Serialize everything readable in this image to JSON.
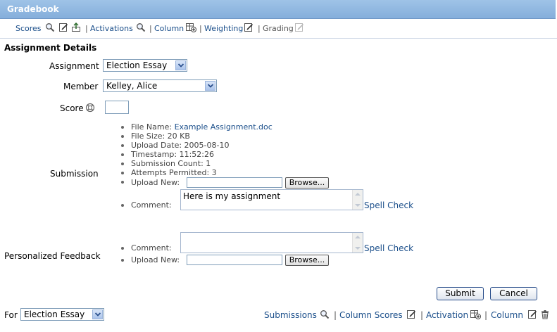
{
  "window": {
    "title": "Gradebook"
  },
  "toolbar": {
    "scores": "Scores",
    "activations": "Activations",
    "column": "Column",
    "weighting": "Weighting",
    "grading": "Grading",
    "separator": "|"
  },
  "section": {
    "title": "Assignment Details"
  },
  "form": {
    "assignment_label": "Assignment",
    "assignment_value": "Election Essay",
    "member_label": "Member",
    "member_value": "Kelley, Alice",
    "score_label": "Score",
    "score_value": "",
    "submission_label": "Submission",
    "file_name_label": "File Name:",
    "file_name": "Example Assignment.doc",
    "file_size": "File Size: 20 KB",
    "upload_date": "Upload Date: 2005-08-10",
    "timestamp": "Timestamp: 11:52:26",
    "submission_count": "Submission Count: 1",
    "attempts_permitted": "Attempts Permitted: 3",
    "upload_new_label": "Upload New:",
    "browse_label": "Browse...",
    "comment_label": "Comment:",
    "comment_value": "Here is my assignment",
    "spell_check": "Spell Check",
    "feedback_label": "Personalized Feedback",
    "feedback_comment_label": "Comment:",
    "feedback_comment_value": "",
    "feedback_spell_check": "Spell Check",
    "feedback_upload_label": "Upload New:",
    "feedback_browse_label": "Browse..."
  },
  "actions": {
    "submit": "Submit",
    "cancel": "Cancel"
  },
  "footer": {
    "for_label": "For",
    "for_value": "Election Essay",
    "submissions": "Submissions",
    "column_scores": "Column Scores",
    "activation": "Activation",
    "column": "Column",
    "separator": "|"
  },
  "icons": {
    "magnifier": "magnifier-icon",
    "edit": "edit-icon",
    "export": "export-icon",
    "add_column": "add-column-icon",
    "delete": "trash-icon",
    "help": "help-lifesaver-icon"
  }
}
